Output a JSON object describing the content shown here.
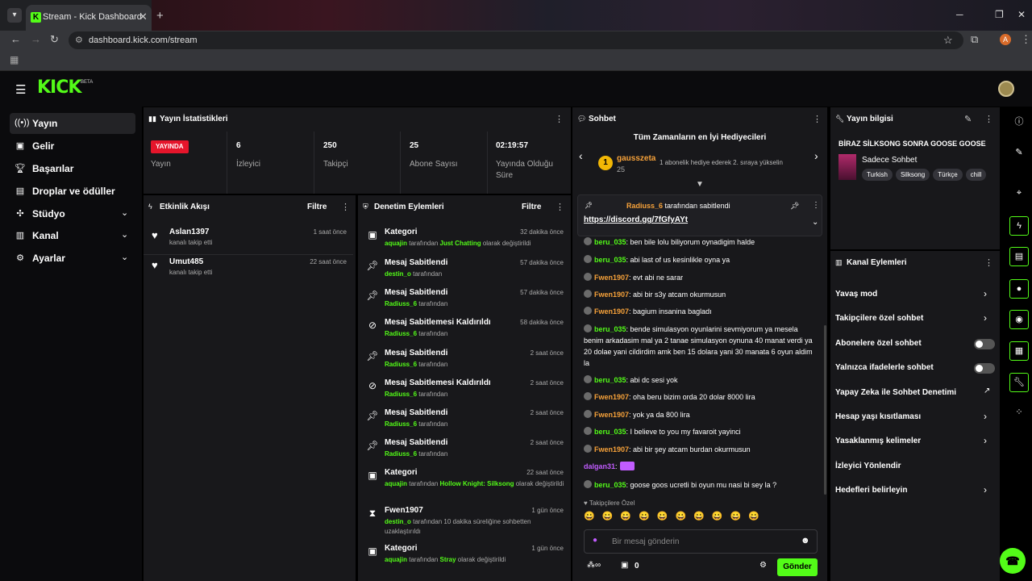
{
  "browser": {
    "tab_title": "Stream - Kick Dashboard",
    "url": "dashboard.kick.com/stream",
    "profile_initial": "A"
  },
  "brand": {
    "logo": "KICK",
    "beta": "BETA",
    "accent": "#53fc18"
  },
  "sidebar": {
    "items": [
      {
        "label": "Yayın",
        "icon": "broadcast-icon"
      },
      {
        "label": "Gelir",
        "icon": "revenue-icon"
      },
      {
        "label": "Başarılar",
        "icon": "trophy-icon"
      },
      {
        "label": "Droplar ve ödüller",
        "icon": "gift-icon"
      },
      {
        "label": "Stüdyo",
        "icon": "studio-icon"
      },
      {
        "label": "Kanal",
        "icon": "channel-icon"
      },
      {
        "label": "Ayarlar",
        "icon": "gear-icon"
      }
    ]
  },
  "stats": {
    "title": "Yayın İstatistikleri",
    "live_badge": "YAYINDA",
    "live_label": "Yayın",
    "viewers": {
      "value": "6",
      "label": "İzleyici"
    },
    "followers": {
      "value": "250",
      "label": "Takipçi"
    },
    "subs": {
      "value": "25",
      "label": "Abone Sayısı"
    },
    "uptime": {
      "value": "02:19:57",
      "label": "Yayında Olduğu Süre"
    }
  },
  "activity": {
    "title": "Etkinlik Akışı",
    "filter": "Filtre",
    "items": [
      {
        "name": "Aslan1397",
        "sub": "kanalı takip etti",
        "time": "1 saat önce"
      },
      {
        "name": "Umut485",
        "sub": "kanalı takip etti",
        "time": "22 saat önce"
      }
    ]
  },
  "moderation": {
    "title": "Denetim Eylemleri",
    "filter": "Filtre",
    "items": [
      {
        "icon": "category-icon",
        "title": "Kategori",
        "time": "32 dakika önce",
        "user": "aquajin",
        "mid": " tarafından ",
        "target": "Just Chatting",
        "end": " olarak değiştirildi"
      },
      {
        "icon": "pin-icon",
        "title": "Mesaj Sabitlendi",
        "time": "57 dakika önce",
        "user": "destin_o",
        "mid": " tarafından",
        "target": "",
        "end": ""
      },
      {
        "icon": "pin-icon",
        "title": "Mesaj Sabitlendi",
        "time": "57 dakika önce",
        "user": "Radiuss_6",
        "mid": " tarafından",
        "target": "",
        "end": ""
      },
      {
        "icon": "unpin-icon",
        "title": "Mesaj Sabitlemesi Kaldırıldı",
        "time": "58 dakika önce",
        "user": "Radiuss_6",
        "mid": " tarafından",
        "target": "",
        "end": ""
      },
      {
        "icon": "pin-icon",
        "title": "Mesaj Sabitlendi",
        "time": "2 saat önce",
        "user": "Radiuss_6",
        "mid": " tarafından",
        "target": "",
        "end": ""
      },
      {
        "icon": "unpin-icon",
        "title": "Mesaj Sabitlemesi Kaldırıldı",
        "time": "2 saat önce",
        "user": "Radiuss_6",
        "mid": " tarafından",
        "target": "",
        "end": ""
      },
      {
        "icon": "pin-icon",
        "title": "Mesaj Sabitlendi",
        "time": "2 saat önce",
        "user": "Radiuss_6",
        "mid": " tarafından",
        "target": "",
        "end": ""
      },
      {
        "icon": "pin-icon",
        "title": "Mesaj Sabitlendi",
        "time": "2 saat önce",
        "user": "Radiuss_6",
        "mid": " tarafından",
        "target": "",
        "end": ""
      },
      {
        "icon": "category-icon",
        "title": "Kategori",
        "time": "22 saat önce",
        "user": "aquajin",
        "mid": " tarafından ",
        "target": "Hollow Knight: Silksong",
        "end": " olarak değiştirildi"
      },
      {
        "icon": "timeout-icon",
        "title": "Fwen1907",
        "time": "1 gün önce",
        "user": "destin_o",
        "mid": " tarafından 10 dakika süreliğine sohbetten uzaklaştırıldı",
        "target": "",
        "end": ""
      },
      {
        "icon": "category-icon",
        "title": "Kategori",
        "time": "1 gün önce",
        "user": "aquajin",
        "mid": " tarafından ",
        "target": "Stray",
        "end": " olarak değiştirildi"
      }
    ]
  },
  "chat": {
    "title": "Sohbet",
    "gifters_title": "Tüm Zamanların en İyi Hediyecileri",
    "top_gifter": {
      "rank": "1",
      "name": "gausszeta",
      "count": "25",
      "hint": "1 abonelik hediye ederek 2. sıraya yükselin"
    },
    "pinned": {
      "by_user": "Radiuss_6",
      "by_text": " tarafından sabitlendi",
      "link": "https://discord.gg/7fGfyAYt"
    },
    "messages": [
      {
        "user": "beru_035",
        "color": "g",
        "text": ": ben bile lolu biliyorum oynadigim halde"
      },
      {
        "user": "beru_035",
        "color": "g",
        "text": ": abi last of us kesinlikle oyna ya"
      },
      {
        "user": "Fwen1907",
        "color": "o",
        "text": ": evt abi ne sarar"
      },
      {
        "user": "Fwen1907",
        "color": "o",
        "text": ": abi bir s3y atcam okurmusun"
      },
      {
        "user": "Fwen1907",
        "color": "o",
        "text": ": bagium insanina bagladı"
      },
      {
        "user": "beru_035",
        "color": "g",
        "text": ": bende simulasyon oyunlarini sevmiyorum ya mesela benim arkadasim mal ya 2 tanae simulasyon oynuna 40 manat verdi ya 20 dolae yani cildirdim amk ben 15 dolara yani 30 manata 6 oyun aldim la"
      },
      {
        "user": "beru_035",
        "color": "g",
        "text": ": abi dc sesi yok"
      },
      {
        "user": "Fwen1907",
        "color": "o",
        "text": ": oha beru bizim orda 20 dolar 8000 lira"
      },
      {
        "user": "Fwen1907",
        "color": "o",
        "text": ": yok ya da 800 lira"
      },
      {
        "user": "beru_035",
        "color": "g",
        "text": ": I believe to you my favaroit yayinci"
      },
      {
        "user": "Fwen1907",
        "color": "o",
        "text": ": abi bir şey atcam burdan okurmusun"
      },
      {
        "user": "dalgan31",
        "color": "p",
        "text": ":"
      },
      {
        "user": "beru_035",
        "color": "g",
        "text": ": goose goos ucretli bi oyun mu nasi bi sey la ?"
      }
    ],
    "followers_only": "Takipçilere Özel",
    "placeholder": "Bir mesaj gönderin",
    "points": "0",
    "send": "Gönder"
  },
  "stream_info": {
    "title": "Yayın bilgisi",
    "stream_title": "BİRAZ SİLKSONG SONRA GOOSE GOOSE",
    "category": "Sadece Sohbet",
    "tags": [
      "Turkish",
      "Silksong",
      "Türkçe",
      "chill"
    ]
  },
  "actions": {
    "title": "Kanal Eylemleri",
    "items": [
      {
        "label": "Yavaş mod",
        "kind": "chevron"
      },
      {
        "label": "Takipçilere özel sohbet",
        "kind": "chevron"
      },
      {
        "label": "Abonelere özel sohbet",
        "kind": "toggle",
        "on": false
      },
      {
        "label": "Yalnızca ifadelerle sohbet",
        "kind": "toggle",
        "on": false
      },
      {
        "label": "Yapay Zeka ile Sohbet Denetimi",
        "kind": "external"
      },
      {
        "label": "Hesap yaşı kısıtlaması",
        "kind": "chevron"
      },
      {
        "label": "Yasaklanmış kelimeler",
        "kind": "chevron"
      },
      {
        "label": "İzleyici Yönlendir",
        "kind": "none"
      },
      {
        "label": "Hedefleri belirleyin",
        "kind": "chevron"
      }
    ]
  }
}
